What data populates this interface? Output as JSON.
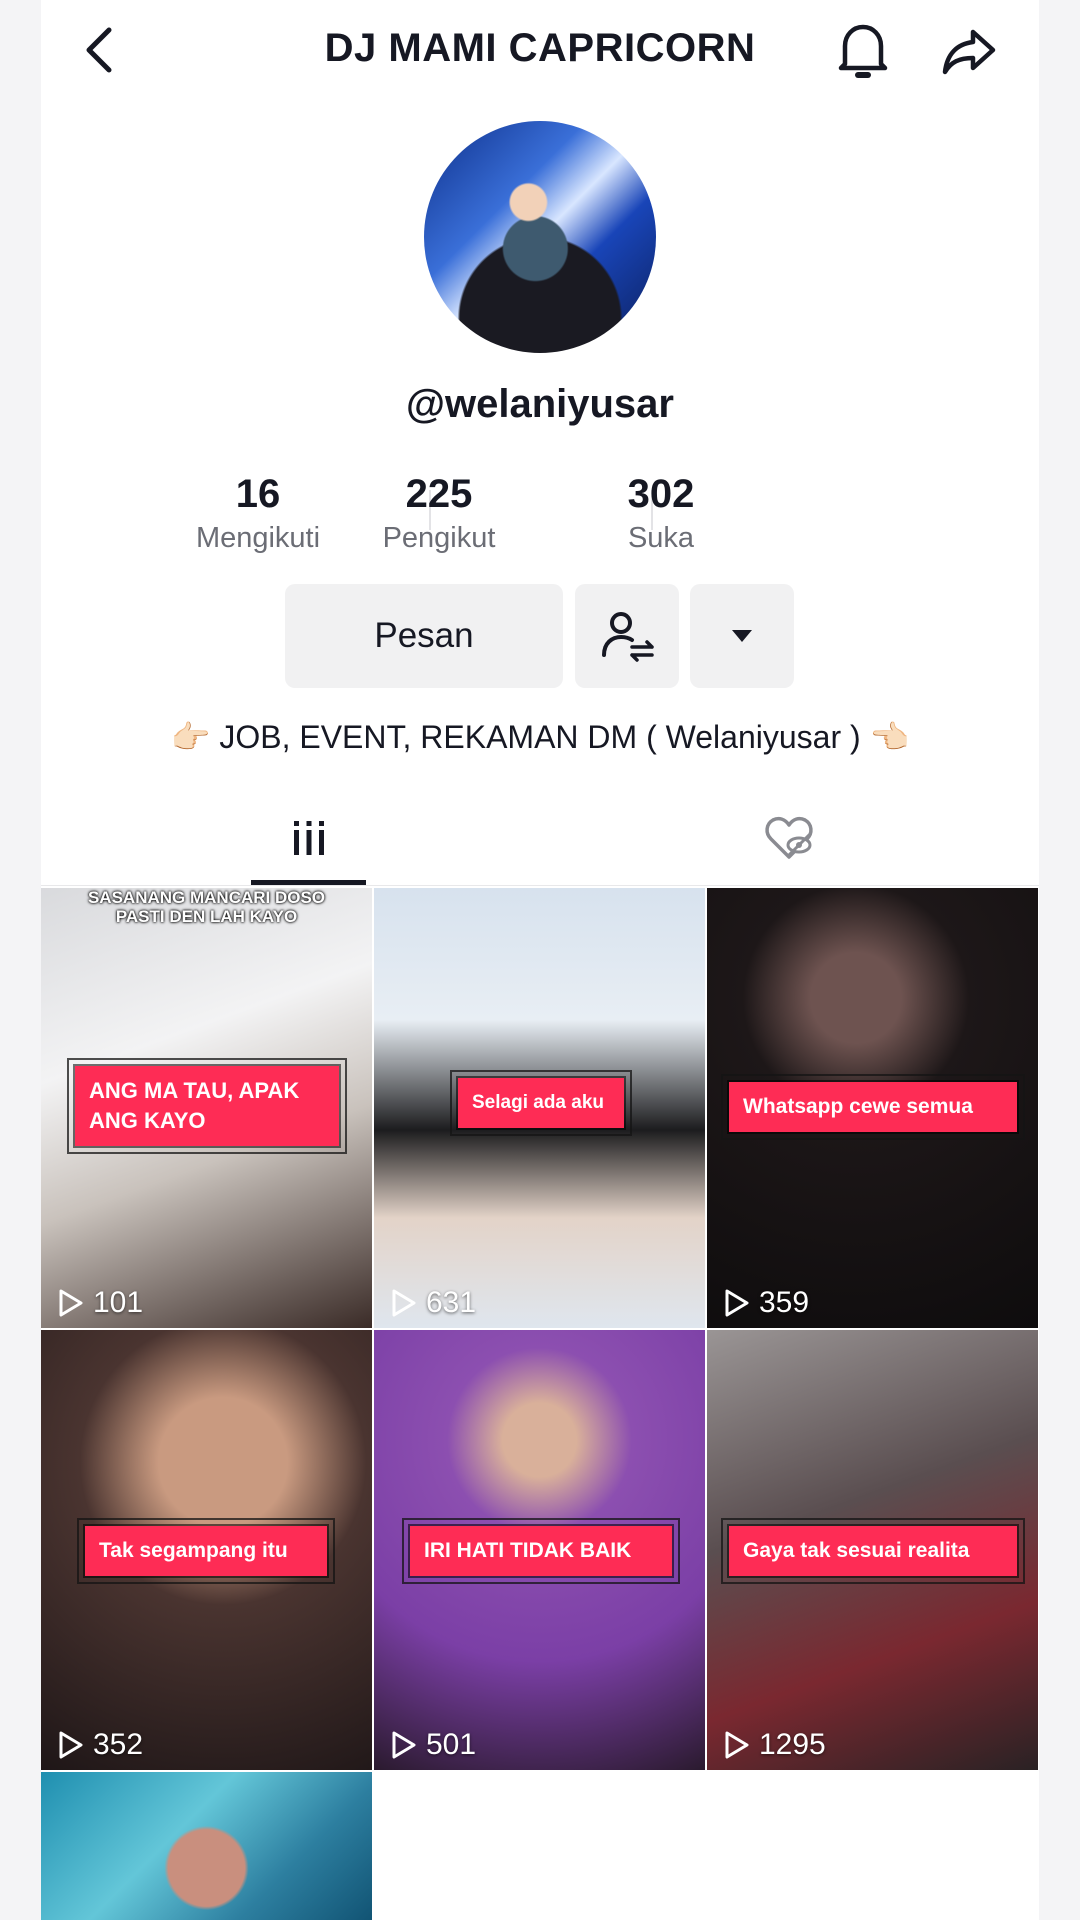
{
  "header": {
    "title": "DJ MAMI CAPRICORN"
  },
  "profile": {
    "handle": "@welaniyusar"
  },
  "stats": [
    {
      "value": "16",
      "label": "Mengikuti"
    },
    {
      "value": "225",
      "label": "Pengikut"
    },
    {
      "value": "302",
      "label": "Suka"
    }
  ],
  "actions": {
    "message_label": "Pesan"
  },
  "bio": "👉🏻 JOB, EVENT, REKAMAN DM ( Welaniyusar ) 👈🏻",
  "videos": [
    {
      "top_text": "SASANANG MANCARI DOSO\nPASTI DEN LAH KAYO",
      "caption": "ANG MA TAU, APAK ANG KAYO",
      "views": "101"
    },
    {
      "caption": "Selagi ada aku",
      "views": "631"
    },
    {
      "caption": "Whatsapp cewe semua",
      "views": "359"
    },
    {
      "caption": "Tak segampang itu",
      "views": "352"
    },
    {
      "caption": "IRI HATI TIDAK BAIK",
      "views": "501"
    },
    {
      "caption": "Gaya tak sesuai realita",
      "views": "1295"
    },
    {
      "caption": "",
      "views": ""
    }
  ],
  "colors": {
    "accent": "#fe2c55",
    "text": "#161823",
    "muted": "#6b6d75",
    "button_bg": "#f1f1f2"
  }
}
